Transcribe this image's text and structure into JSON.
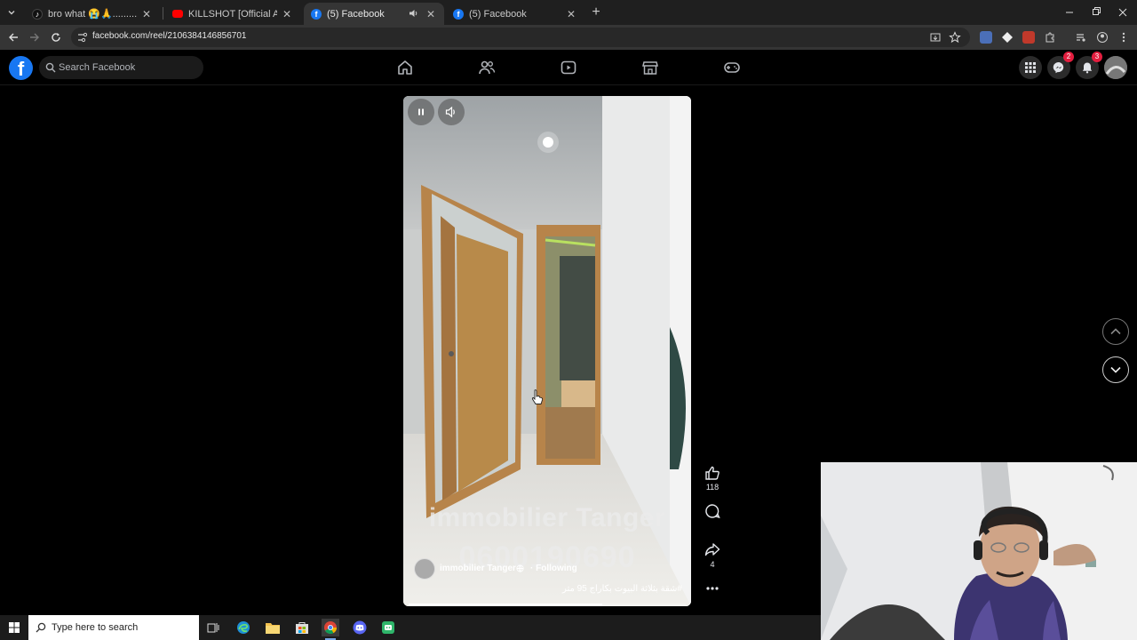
{
  "browser": {
    "tabs": [
      {
        "title": "bro what 😭🙏........................#fy",
        "favicon": "tiktok-icon",
        "active": false
      },
      {
        "title": "KILLSHOT [Official Audio] - You",
        "favicon": "youtube-icon",
        "active": false
      },
      {
        "title": "(5) Facebook",
        "favicon": "facebook-icon",
        "active": true,
        "audio": true
      },
      {
        "title": "(5) Facebook",
        "favicon": "facebook-icon",
        "active": false
      }
    ],
    "url": "facebook.com/reel/2106384146856701"
  },
  "facebook": {
    "logo": "f",
    "search_placeholder": "Search Facebook",
    "nav_icons": [
      "home-icon",
      "friends-icon",
      "video-icon",
      "marketplace-icon",
      "gaming-icon"
    ],
    "messenger_badge": "2",
    "notifications_badge": "3"
  },
  "reel": {
    "overlay_line1": "immobilier Tanger",
    "overlay_line2": "0600190690",
    "channel_name": "immobilier Tanger",
    "follow_status": "· Following",
    "caption": "#شقة بثلاثة البيوت بكاراج 95 متر",
    "progress": 0.7,
    "likes": "118",
    "shares": "4"
  },
  "taskbar": {
    "search_placeholder": "Type here to search"
  },
  "colors": {
    "facebook_blue": "#1877f2",
    "badge_red": "#e41e3f",
    "background": "#000000"
  }
}
